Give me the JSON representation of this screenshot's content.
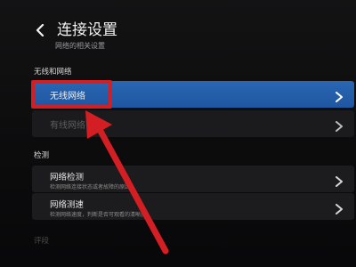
{
  "header": {
    "title": "连接设置",
    "subtitle": "网络的相关设置"
  },
  "sections": {
    "wireless_header": "无线和网络",
    "detect_header": "检测",
    "next_header": "评段"
  },
  "rows": {
    "wireless": {
      "label": "无线网络"
    },
    "wired": {
      "label": "有线网络"
    },
    "detect": {
      "title": "网络检测",
      "desc": "检测网络连接状态或者故障的原因"
    },
    "speed": {
      "title": "网络测速",
      "desc": "检测网络速度，判断是否可观看的清晰度"
    }
  },
  "colors": {
    "selected_row": "#2563a8",
    "annotation": "#d31f23"
  },
  "icons": {
    "back": "chevron-left-icon",
    "row_arrow": "chevron-right-icon"
  }
}
